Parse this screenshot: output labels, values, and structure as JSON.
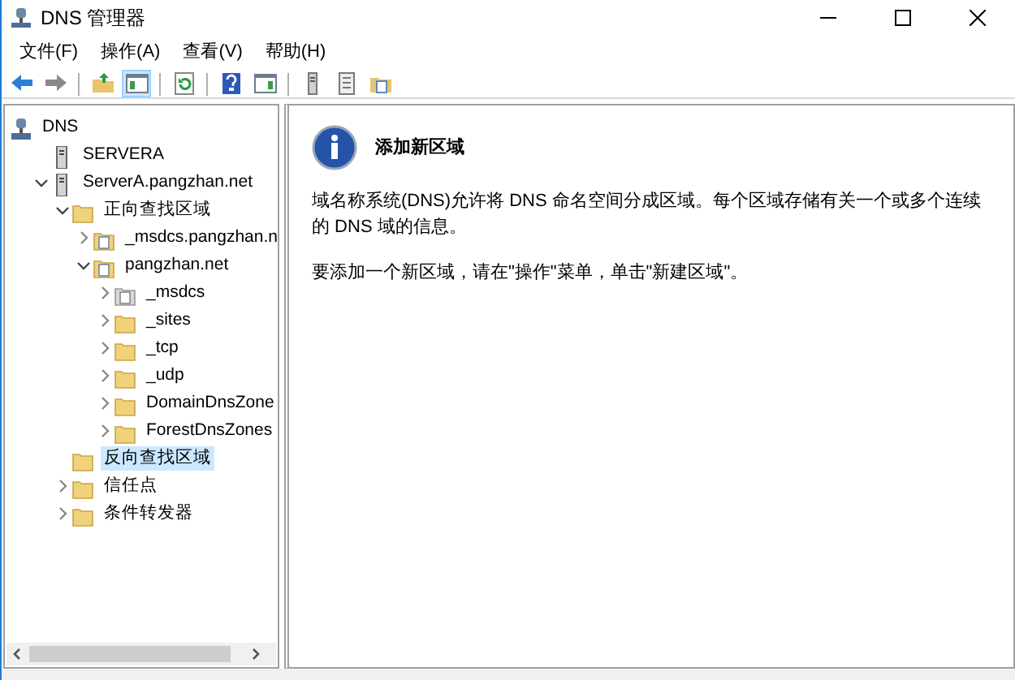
{
  "window": {
    "title": "DNS 管理器"
  },
  "menu": [
    "文件(F)",
    "操作(A)",
    "查看(V)",
    "帮助(H)"
  ],
  "toolbar": [
    {
      "kind": "back",
      "pressed": false
    },
    {
      "kind": "forward",
      "pressed": false
    },
    {
      "kind": "sep"
    },
    {
      "kind": "up",
      "pressed": false
    },
    {
      "kind": "tree",
      "pressed": true
    },
    {
      "kind": "sep"
    },
    {
      "kind": "refresh",
      "pressed": false
    },
    {
      "kind": "sep"
    },
    {
      "kind": "help",
      "pressed": false
    },
    {
      "kind": "pane",
      "pressed": false
    },
    {
      "kind": "sep"
    },
    {
      "kind": "server",
      "pressed": false
    },
    {
      "kind": "list",
      "pressed": false
    },
    {
      "kind": "export",
      "pressed": false
    }
  ],
  "tree": [
    {
      "label": "DNS",
      "kind": "dns",
      "selected": false,
      "children": [
        {
          "label": "SERVERA",
          "kind": "server",
          "selected": false
        },
        {
          "label": "ServerA.pangzhan.net",
          "kind": "server",
          "expanded": true,
          "selected": false,
          "children": [
            {
              "label": "正向查找区域",
              "kind": "folder",
              "expanded": true,
              "selected": false,
              "children": [
                {
                  "label": "_msdcs.pangzhan.n",
                  "kind": "zone",
                  "expanded": false,
                  "selected": false
                },
                {
                  "label": "pangzhan.net",
                  "kind": "zone",
                  "expanded": true,
                  "selected": false,
                  "children": [
                    {
                      "label": "_msdcs",
                      "kind": "delegated",
                      "expanded": false,
                      "selected": false
                    },
                    {
                      "label": "_sites",
                      "kind": "folder",
                      "expanded": false,
                      "selected": false
                    },
                    {
                      "label": "_tcp",
                      "kind": "folder",
                      "expanded": false,
                      "selected": false
                    },
                    {
                      "label": "_udp",
                      "kind": "folder",
                      "expanded": false,
                      "selected": false
                    },
                    {
                      "label": "DomainDnsZone",
                      "kind": "folder",
                      "expanded": false,
                      "selected": false
                    },
                    {
                      "label": "ForestDnsZones",
                      "kind": "folder",
                      "expanded": false,
                      "selected": false
                    }
                  ]
                }
              ]
            },
            {
              "label": "反向查找区域",
              "kind": "folder",
              "selected": true
            },
            {
              "label": "信任点",
              "kind": "folder",
              "expanded": false,
              "selected": false
            },
            {
              "label": "条件转发器",
              "kind": "folder",
              "expanded": false,
              "selected": false
            }
          ]
        }
      ]
    }
  ],
  "content": {
    "heading": "添加新区域",
    "paragraphs": [
      "域名称系统(DNS)允许将 DNS 命名空间分成区域。每个区域存储有关一个或多个连续的 DNS 域的信息。",
      "要添加一个新区域，请在\"操作\"菜单，单击\"新建区域\"。"
    ]
  }
}
